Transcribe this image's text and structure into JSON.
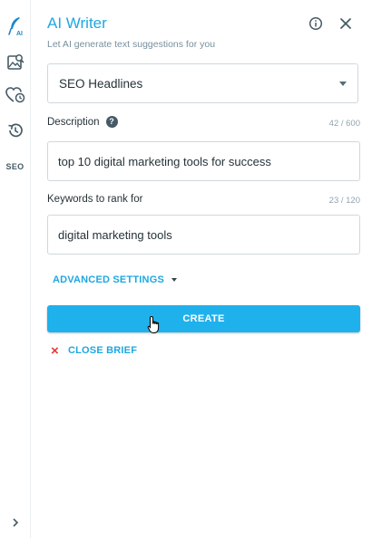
{
  "header": {
    "title": "AI Writer",
    "subtitle": "Let AI generate text suggestions for you"
  },
  "rail": {
    "logo_icon": "feather-ai-icon",
    "logo_text": "AI",
    "items": [
      {
        "icon": "image-search-icon"
      },
      {
        "icon": "heart-clock-icon"
      },
      {
        "icon": "history-icon"
      },
      {
        "label": "SEO"
      }
    ],
    "expand_icon": "chevron-right-icon"
  },
  "form": {
    "template_select": {
      "value": "SEO Headlines"
    },
    "description": {
      "label": "Description",
      "help": "?",
      "counter": "42 / 600",
      "value": "top 10 digital marketing tools for success"
    },
    "keywords": {
      "label": "Keywords to rank for",
      "counter": "23 / 120",
      "value": "digital marketing tools"
    },
    "advanced_label": "ADVANCED SETTINGS",
    "create_label": "CREATE",
    "close_brief_label": "CLOSE BRIEF",
    "close_brief_icon": "×"
  },
  "colors": {
    "accent": "#1ea7e1",
    "button": "#1fb1ec",
    "close": "#e53935",
    "border": "#cfd8dc"
  }
}
